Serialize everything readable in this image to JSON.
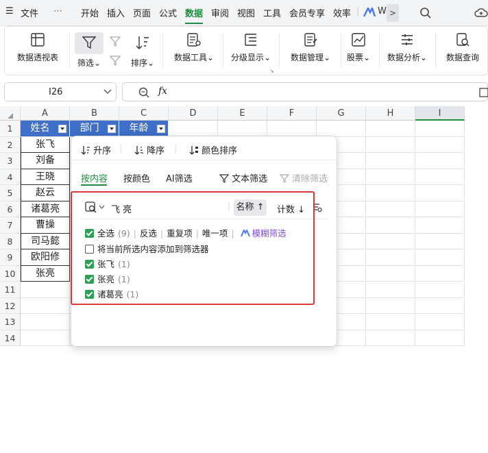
{
  "menubar": {
    "menu_icon": "hamburger-icon",
    "file": "文件",
    "more": "⋯",
    "tabs": [
      "开始",
      "插入",
      "页面",
      "公式",
      "数据",
      "审阅",
      "视图",
      "工具",
      "会员专享",
      "效率"
    ],
    "active_tab": "数据",
    "ai_label": "W",
    "next_arrow": ">"
  },
  "ribbon": {
    "pivot": "数据透视表",
    "filter": "筛选",
    "sort": "排序",
    "data_tools": "数据工具",
    "outline": "分级显示",
    "data_manage": "数据管理",
    "stocks": "股票",
    "analysis": "数据分析",
    "query": "数据查询",
    "caret": "⌄"
  },
  "formula_bar": {
    "cell_ref": "I26",
    "fx": "fx",
    "value": ""
  },
  "grid": {
    "columns": [
      "A",
      "B",
      "C",
      "D",
      "E",
      "F",
      "G",
      "H",
      "I"
    ],
    "selected_column": "I",
    "rows": [
      "1",
      "2",
      "3",
      "4",
      "5",
      "6",
      "7",
      "8",
      "9",
      "10",
      "11",
      "12",
      "13",
      "14"
    ],
    "headers": [
      "姓名",
      "部门",
      "年龄"
    ],
    "names": [
      "张飞",
      "刘备",
      "王晓",
      "赵云",
      "诸葛亮",
      "曹操",
      "司马懿",
      "欧阳修",
      "张亮"
    ]
  },
  "filter_popup": {
    "sort_asc": "升序",
    "sort_desc": "降序",
    "sort_color": "颜色排序",
    "tabs": [
      "按内容",
      "按颜色",
      "AI筛选"
    ],
    "text_filter": "文本筛选",
    "clear_filter": "清除筛选",
    "search_text": "飞 亮",
    "sort_by_name": "名称",
    "sort_by_count": "计数",
    "select_all": "全选",
    "select_all_count": "(9)",
    "invert": "反选",
    "duplicates": "重复项",
    "unique": "唯一项",
    "fuzzy": "模糊筛选",
    "add_to_filter": "将当前所选内容添加到筛选器",
    "items": [
      {
        "label": "张飞",
        "count": "(1)",
        "checked": true
      },
      {
        "label": "张亮",
        "count": "(1)",
        "checked": true
      },
      {
        "label": "诸葛亮",
        "count": "(1)",
        "checked": true
      }
    ]
  },
  "colors": {
    "accent": "#1e8e3e",
    "header_fill": "#3f6fc8",
    "highlight_box": "#d9383a",
    "checkbox": "#2e9e58",
    "fuzzy": "#7b4fd8"
  }
}
